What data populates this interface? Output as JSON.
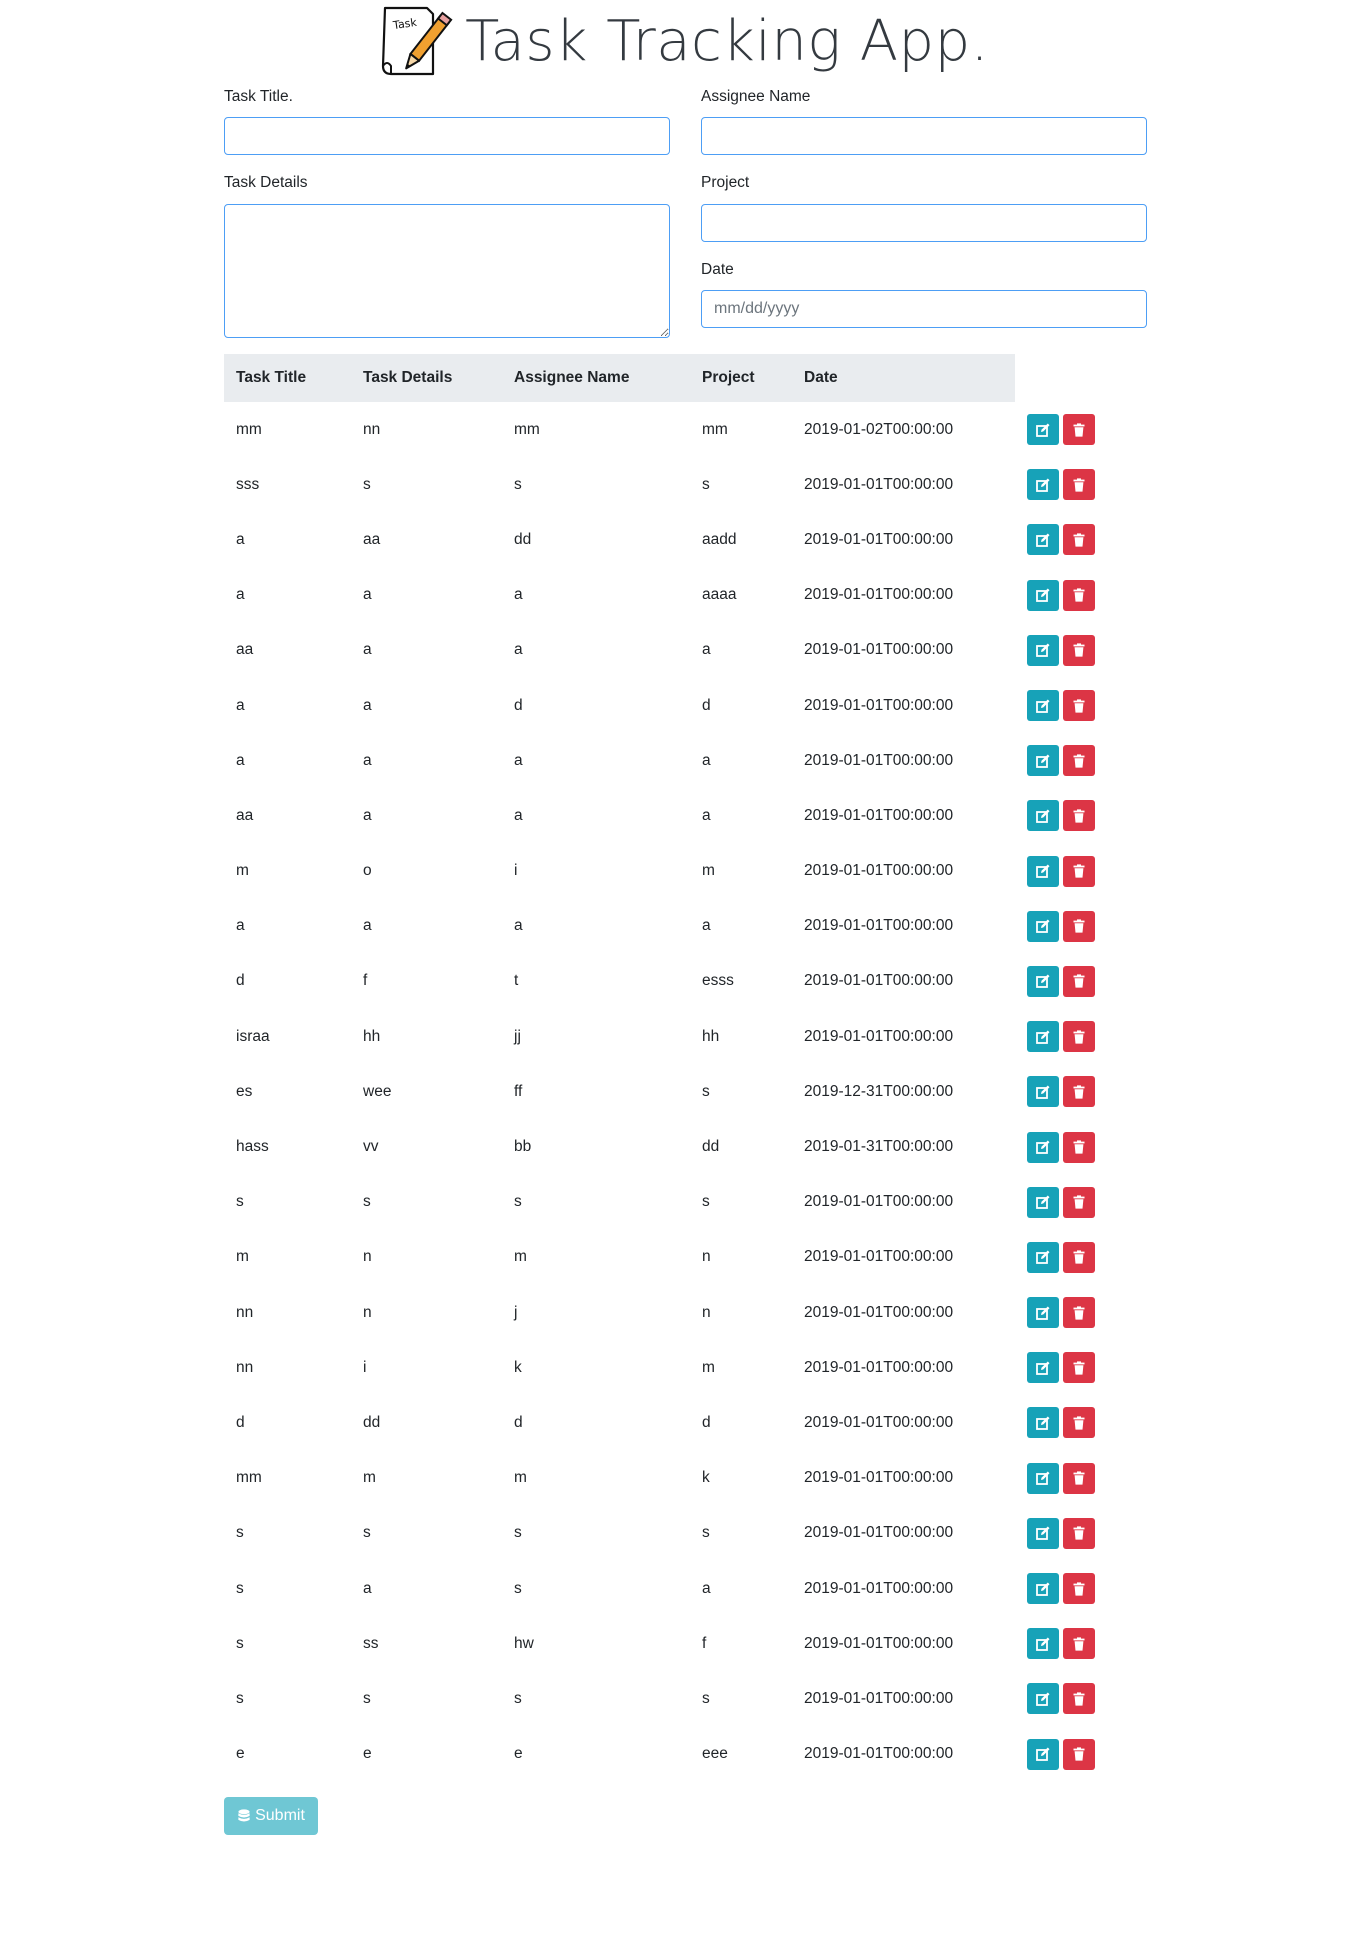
{
  "header": {
    "title": "Task Tracking App.",
    "logo_text": "Task"
  },
  "form": {
    "task_title_label": "Task Title.",
    "assignee_label": "Assignee Name",
    "details_label": "Task Details",
    "project_label": "Project",
    "date_label": "Date",
    "task_title_value": "",
    "assignee_value": "",
    "details_value": "",
    "project_value": "",
    "date_placeholder": "mm/dd/yyyy"
  },
  "table": {
    "headers": [
      "Task Title",
      "Task Details",
      "Assignee Name",
      "Project",
      "Date"
    ],
    "rows": [
      [
        "mm",
        "nn",
        "mm",
        "mm",
        "2019-01-02T00:00:00"
      ],
      [
        "sss",
        "s",
        "s",
        "s",
        "2019-01-01T00:00:00"
      ],
      [
        "a",
        "aa",
        "dd",
        "aadd",
        "2019-01-01T00:00:00"
      ],
      [
        "a",
        "a",
        "a",
        "aaaa",
        "2019-01-01T00:00:00"
      ],
      [
        "aa",
        "a",
        "a",
        "a",
        "2019-01-01T00:00:00"
      ],
      [
        "a",
        "a",
        "d",
        "d",
        "2019-01-01T00:00:00"
      ],
      [
        "a",
        "a",
        "a",
        "a",
        "2019-01-01T00:00:00"
      ],
      [
        "aa",
        "a",
        "a",
        "a",
        "2019-01-01T00:00:00"
      ],
      [
        "m",
        "o",
        "i",
        "m",
        "2019-01-01T00:00:00"
      ],
      [
        "a",
        "a",
        "a",
        "a",
        "2019-01-01T00:00:00"
      ],
      [
        "d",
        "f",
        "t",
        "esss",
        "2019-01-01T00:00:00"
      ],
      [
        "israa",
        "hh",
        "jj",
        "hh",
        "2019-01-01T00:00:00"
      ],
      [
        "es",
        "wee",
        "ff",
        "s",
        "2019-12-31T00:00:00"
      ],
      [
        "hass",
        "vv",
        "bb",
        "dd",
        "2019-01-31T00:00:00"
      ],
      [
        "s",
        "s",
        "s",
        "s",
        "2019-01-01T00:00:00"
      ],
      [
        "m",
        "n",
        "m",
        "n",
        "2019-01-01T00:00:00"
      ],
      [
        "nn",
        "n",
        "j",
        "n",
        "2019-01-01T00:00:00"
      ],
      [
        "nn",
        "i",
        "k",
        "m",
        "2019-01-01T00:00:00"
      ],
      [
        "d",
        "dd",
        "d",
        "d",
        "2019-01-01T00:00:00"
      ],
      [
        "mm",
        "m",
        "m",
        "k",
        "2019-01-01T00:00:00"
      ],
      [
        "s",
        "s",
        "s",
        "s",
        "2019-01-01T00:00:00"
      ],
      [
        "s",
        "a",
        "s",
        "a",
        "2019-01-01T00:00:00"
      ],
      [
        "s",
        "ss",
        "hw",
        "f",
        "2019-01-01T00:00:00"
      ],
      [
        "s",
        "s",
        "s",
        "s",
        "2019-01-01T00:00:00"
      ],
      [
        "e",
        "e",
        "e",
        "eee",
        "2019-01-01T00:00:00"
      ]
    ],
    "row_action_icons": [
      "edit-icon",
      "trash-icon"
    ]
  },
  "submit": {
    "label": "Submit",
    "icon": "database-icon"
  },
  "colors": {
    "edit": "#17a2b8",
    "delete": "#dc3545",
    "submit": "#6fc7d4",
    "header_bg": "#e9ecef",
    "field_border": "#4d9ef5"
  }
}
